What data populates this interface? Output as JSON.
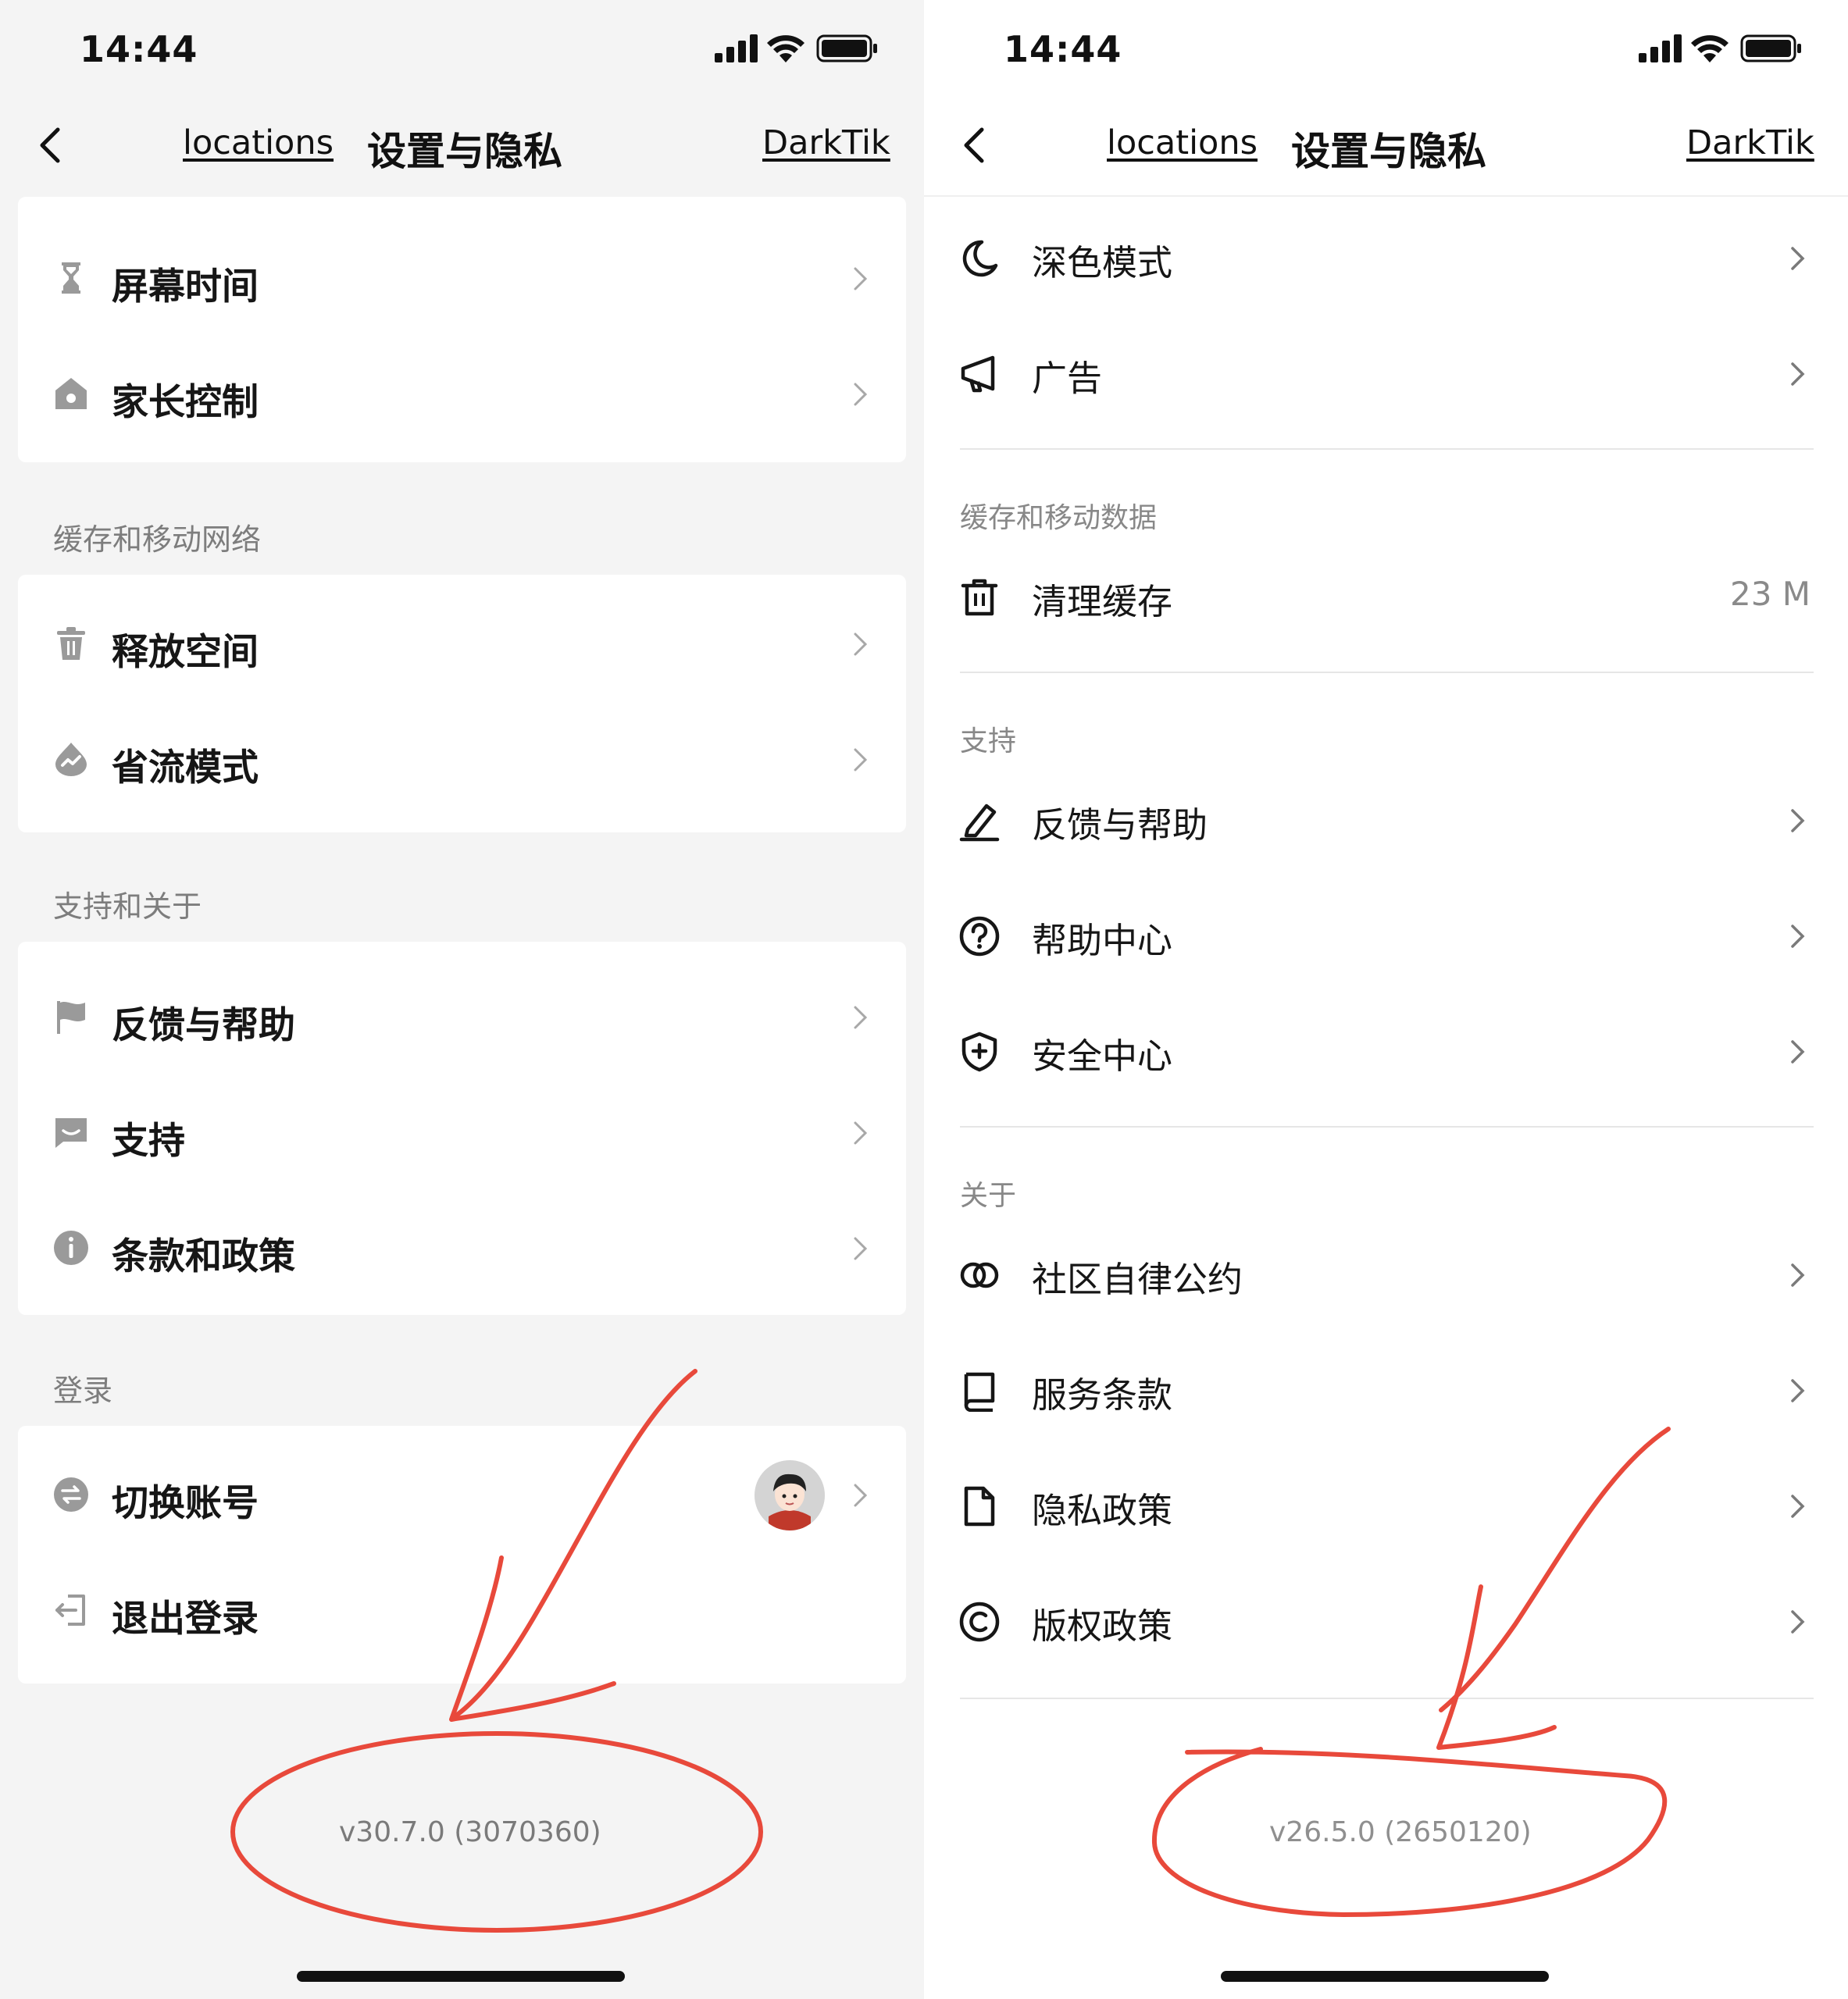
{
  "left": {
    "status": {
      "time": "14:44"
    },
    "nav": {
      "locations": "locations",
      "title": "设置与隐私",
      "darktik": "DarkTik"
    },
    "group1": [
      {
        "label": "屏幕时间",
        "icon": "hourglass-icon"
      },
      {
        "label": "家长控制",
        "icon": "home-shield-icon"
      }
    ],
    "section_cache": "缓存和移动网络",
    "group2": [
      {
        "label": "释放空间",
        "icon": "trash-icon"
      },
      {
        "label": "省流模式",
        "icon": "data-saver-icon"
      }
    ],
    "section_support": "支持和关于",
    "group3": [
      {
        "label": "反馈与帮助",
        "icon": "flag-icon"
      },
      {
        "label": "支持",
        "icon": "chat-icon"
      },
      {
        "label": "条款和政策",
        "icon": "info-icon"
      }
    ],
    "section_login": "登录",
    "group4": [
      {
        "label": "切换账号",
        "icon": "switch-icon"
      },
      {
        "label": "退出登录",
        "icon": "logout-icon"
      }
    ],
    "version": "v30.7.0 (3070360)"
  },
  "right": {
    "status": {
      "time": "14:44"
    },
    "nav": {
      "locations": "locations",
      "title": "设置与隐私",
      "darktik": "DarkTik"
    },
    "group1": [
      {
        "label": "深色模式",
        "icon": "moon-icon"
      },
      {
        "label": "广告",
        "icon": "megaphone-icon"
      }
    ],
    "section_cache": "缓存和移动数据",
    "clear_cache": {
      "label": "清理缓存",
      "value": "23 M",
      "icon": "trash-icon"
    },
    "section_support": "支持",
    "group2": [
      {
        "label": "反馈与帮助",
        "icon": "pencil-icon"
      },
      {
        "label": "帮助中心",
        "icon": "question-icon"
      },
      {
        "label": "安全中心",
        "icon": "shield-icon"
      }
    ],
    "section_about": "关于",
    "group3": [
      {
        "label": "社区自律公约",
        "icon": "rings-icon"
      },
      {
        "label": "服务条款",
        "icon": "book-icon"
      },
      {
        "label": "隐私政策",
        "icon": "document-icon"
      },
      {
        "label": "版权政策",
        "icon": "copyright-icon"
      }
    ],
    "version": "v26.5.0 (2650120)"
  },
  "colors": {
    "annotation": "#e8493b",
    "left_bg": "#f4f4f4",
    "right_bg": "#ffffff",
    "icon_gray": "#9a9a9a"
  }
}
